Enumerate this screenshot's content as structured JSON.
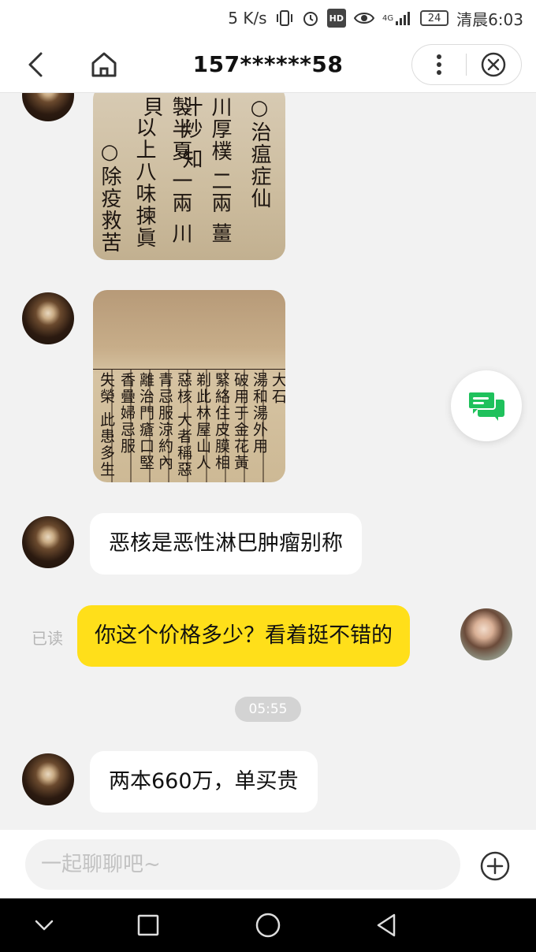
{
  "status_bar": {
    "net_speed": "5 K/s",
    "hd": "HD",
    "network": "4G",
    "battery": "24",
    "time": "清晨6:03"
  },
  "nav": {
    "title": "157******58"
  },
  "messages": {
    "msg3_text": "恶核是恶性淋巴肿瘤别称",
    "msg4_text": "你这个价格多少？看着挺不错的",
    "read_status": "已读",
    "timestamp": "05:55",
    "msg5_text": "两本660万，单买贵"
  },
  "image1": {
    "columns": [
      "○治瘟症仙",
      "川厚樸 二兩 薑汁炒 知",
      "製半夏 一兩 川貝",
      "以上八味揀眞",
      "○除疫救苦"
    ]
  },
  "image2": {
    "columns": [
      "大石",
      "湯和湯外用",
      "破用于金花黃",
      "緊絡住皮膜相",
      "剃此林屋山人",
      "惡核 大者稱惡",
      "青忌服涼約內",
      "離治門瘡口堅",
      "香疊婦忌服",
      "失榮 此患多生"
    ]
  },
  "input": {
    "placeholder": "一起聊聊吧~"
  },
  "colors": {
    "self_bubble": "#ffdf1a",
    "other_bubble": "#ffffff",
    "chat_bg": "#f2f2f2",
    "float_icon": "#1fc15c"
  },
  "icons": {
    "status": [
      "vibrate-icon",
      "alarm-icon",
      "hd-icon",
      "eye-icon",
      "signal-icon",
      "battery-icon"
    ],
    "nav": [
      "back-icon",
      "home-icon",
      "more-icon",
      "close-icon"
    ],
    "chat": [
      "chat-float-icon",
      "add-icon"
    ],
    "system": [
      "sys-back-icon",
      "sys-home-icon",
      "sys-recents-icon",
      "sys-collapse-icon"
    ]
  }
}
